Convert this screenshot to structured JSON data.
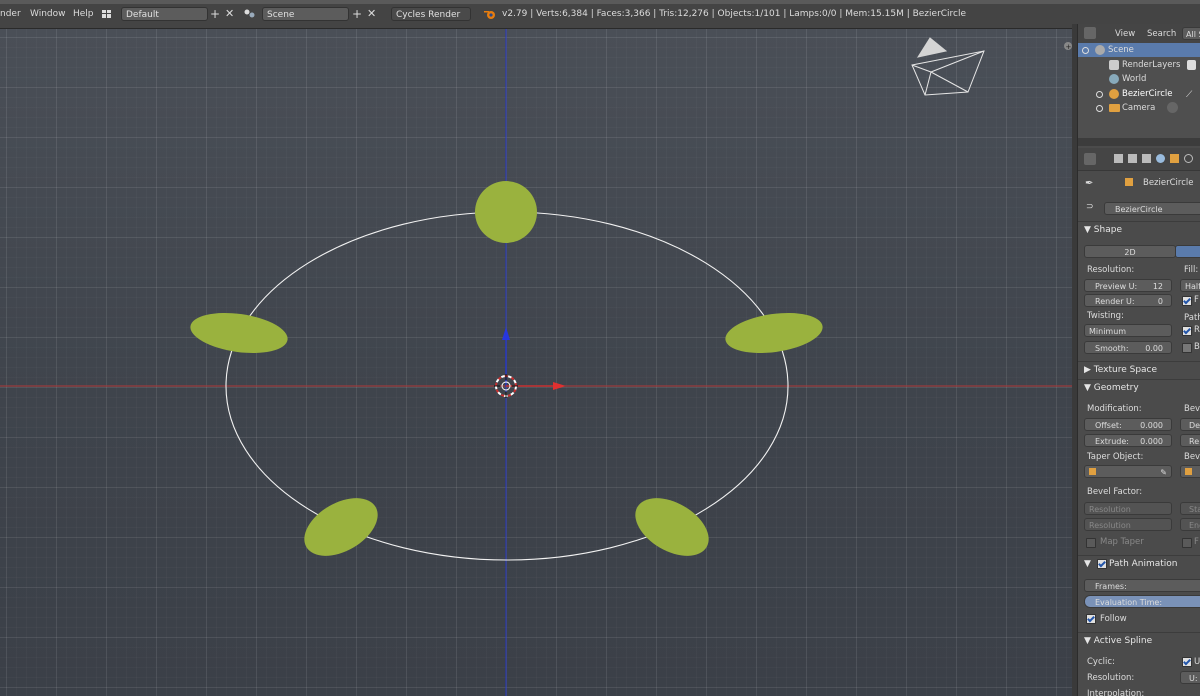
{
  "topbar": {
    "menu_render": "nder",
    "menu_window": "Window",
    "menu_help": "Help",
    "layout_field": "Default",
    "scene_field": "Scene",
    "engine_field": "Cycles Render",
    "stats": "v2.79 | Verts:6,384 | Faces:3,366 | Tris:12,276 | Objects:1/101 | Lamps:0/0 | Mem:15.15M | BezierCircle"
  },
  "outliner": {
    "menu_view": "View",
    "menu_search": "Search",
    "menu_all": "All S",
    "rows": [
      "Scene",
      "RenderLayers",
      "World",
      "BezierCircle",
      "Camera"
    ]
  },
  "properties": {
    "object_name": "BezierCircle",
    "data_name": "BezierCircle",
    "shape": {
      "title": "Shape",
      "tab_2d": "2D",
      "resolution_label": "Resolution:",
      "fill_label": "Fill:",
      "preview_label": "Preview U:",
      "preview_value": "12",
      "render_label": "Render U:",
      "render_value": "0",
      "fill_value": "Half",
      "twisting_label": "Twisting:",
      "path_label": "Path",
      "twisting_value": "Minimum",
      "smooth_label": "Smooth:",
      "smooth_value": "0.00",
      "fill_check": "F",
      "path_check_r": "R",
      "path_check_b": "B"
    },
    "texture_space": "Texture Space",
    "geometry": {
      "title": "Geometry",
      "modification_label": "Modification:",
      "bevel_label": "Beve",
      "offset_label": "Offset:",
      "offset_value": "0.000",
      "depth_label": "De",
      "extrude_label": "Extrude:",
      "extrude_value": "0.000",
      "res_label": "Re",
      "taper_label": "Taper Object:",
      "bevel_obj_label": "Beve",
      "bevel_factor_label": "Bevel Factor:",
      "resolution_a": "Resolution",
      "resolution_b": "Resolution",
      "start_label": "Star",
      "end_label": "End:",
      "map_taper": "Map Taper",
      "f_label": "F"
    },
    "path_animation": {
      "title": "Path Animation",
      "frames_label": "Frames:",
      "eval_label": "Evaluation Time:",
      "follow_label": "Follow"
    },
    "active_spline": {
      "title": "Active Spline",
      "cyclic_label": "Cyclic:",
      "cyclic_u": "U",
      "resolution_label": "Resolution:",
      "res_u": "U:",
      "interp_label": "Interpolation:"
    }
  },
  "colors": {
    "blob": "#9ab23e",
    "x_axis": "#c83030",
    "y_axis": "#2030c8",
    "selection": "#5a7bac"
  }
}
